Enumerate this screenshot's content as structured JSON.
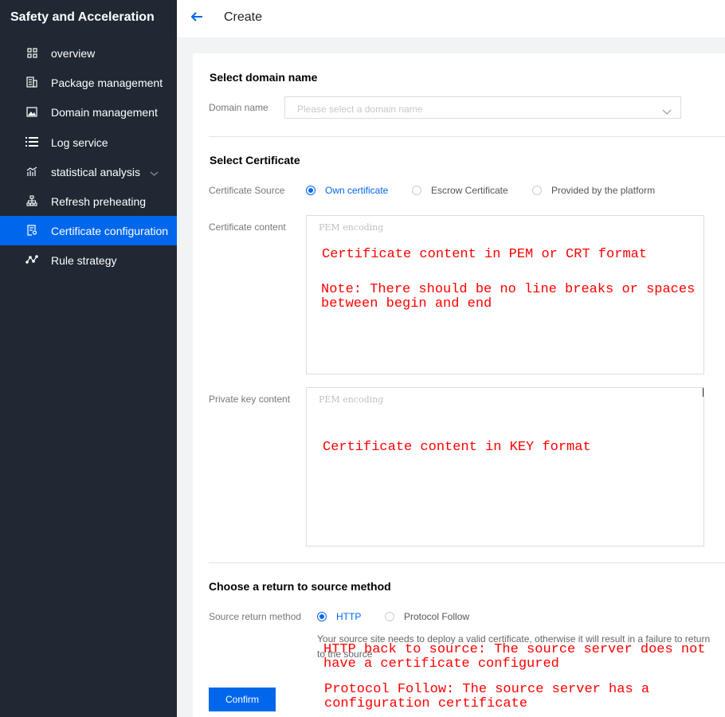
{
  "sidebar": {
    "title": "Safety and Acceleration",
    "items": [
      {
        "label": "overview",
        "icon": "grid-icon"
      },
      {
        "label": "Package management",
        "icon": "package-icon"
      },
      {
        "label": "Domain management",
        "icon": "image-icon"
      },
      {
        "label": "Log service",
        "icon": "list-icon"
      },
      {
        "label": "statistical analysis",
        "icon": "chart-icon"
      },
      {
        "label": "Refresh preheating",
        "icon": "hierarchy-icon"
      },
      {
        "label": "Certificate configuration",
        "icon": "certificate-icon",
        "active": true
      },
      {
        "label": "Rule strategy",
        "icon": "rule-icon"
      }
    ]
  },
  "header": {
    "title": "Create"
  },
  "domain_section": {
    "title": "Select domain name",
    "label": "Domain name",
    "placeholder": "Please select a domain name"
  },
  "cert_section": {
    "title": "Select Certificate",
    "source_label": "Certificate Source",
    "sources": [
      "Own certificate",
      "Escrow Certificate",
      "Provided by the platform"
    ],
    "selected_source": "Own certificate",
    "content_label": "Certificate content",
    "content_placeholder": "PEM encoding",
    "key_label": "Private key content",
    "key_placeholder": "PEM encoding"
  },
  "source_section": {
    "title": "Choose a return to source method",
    "label": "Source return method",
    "options": [
      "HTTP",
      "Protocol Follow"
    ],
    "selected": "HTTP",
    "hint": "Your source site needs to deploy a valid certificate, otherwise it will result in a failure to return to the source"
  },
  "confirm_label": "Confirm",
  "annotations": {
    "cert_line1": "Certificate content in PEM or CRT format",
    "cert_note": "Note: There should be no line breaks or spaces\nbetween begin and end",
    "key_note": "Certificate content in KEY format",
    "http_note": "HTTP back to source: The source server does not\nhave a certificate configured",
    "follow_note": "Protocol Follow: The source server has a\nconfiguration certificate"
  },
  "colors": {
    "sidebar_bg": "#202833",
    "accent": "#0067ed",
    "annotation": "#ff0000"
  }
}
